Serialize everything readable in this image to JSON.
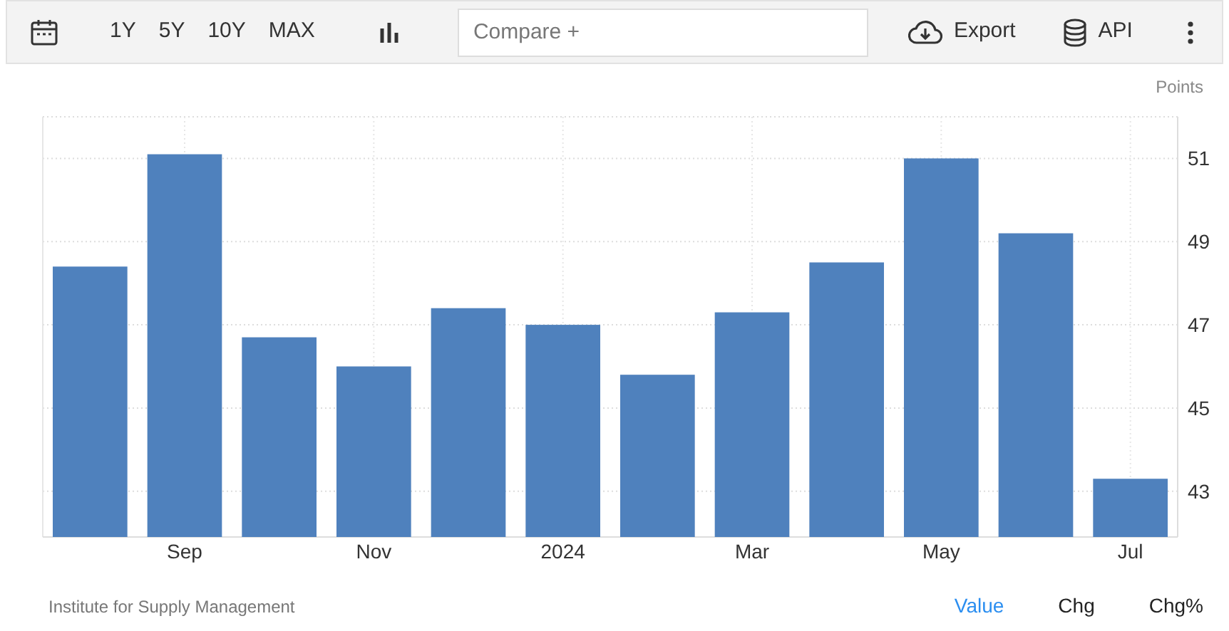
{
  "toolbar": {
    "ranges": [
      {
        "label": "1Y"
      },
      {
        "label": "5Y"
      },
      {
        "label": "10Y"
      },
      {
        "label": "MAX"
      }
    ],
    "compare": {
      "placeholder": "Compare +"
    },
    "export": "Export",
    "api": "API"
  },
  "chart": {
    "chart_data": {
      "type": "bar",
      "ylabel": "Points",
      "values": [
        48.4,
        51.1,
        46.7,
        46.0,
        47.4,
        47.0,
        45.8,
        47.3,
        48.5,
        51.0,
        49.2,
        43.3
      ],
      "categories": [
        null,
        "Sep",
        null,
        "Nov",
        null,
        "2024",
        null,
        "Mar",
        null,
        "May",
        null,
        "Jul"
      ],
      "grid": true,
      "yticks": [
        43,
        45,
        47,
        49,
        51
      ],
      "ylim": [
        41.9,
        52
      ]
    }
  },
  "source": "Institute for Supply Management",
  "views": [
    {
      "label": "Value",
      "selected": true
    },
    {
      "label": "Chg",
      "selected": false
    },
    {
      "label": "Chg%",
      "selected": false
    }
  ]
}
